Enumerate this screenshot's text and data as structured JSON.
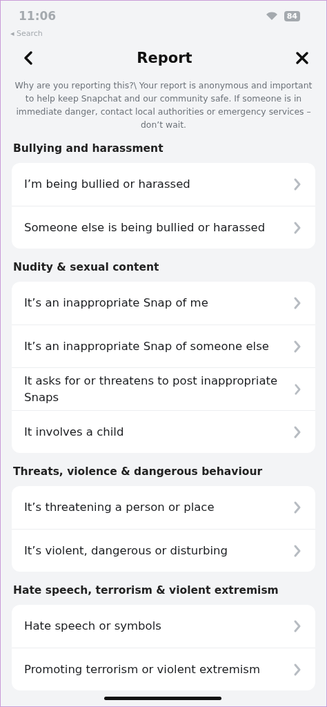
{
  "status_bar": {
    "time": "11:06",
    "back_link": "◂ Search",
    "battery": "84"
  },
  "header": {
    "title": "Report"
  },
  "intro": "Why are you reporting this?\\ Your report is anonymous and important to help keep Snapchat and our community safe. If someone is in immediate danger, contact local authorities or emergency services – don’t wait.",
  "sections": [
    {
      "title": "Bullying and harassment",
      "items": [
        "I’m being bullied or harassed",
        "Someone else is being bullied or harassed"
      ]
    },
    {
      "title": "Nudity & sexual content",
      "items": [
        "It’s an inappropriate Snap of me",
        "It’s an inappropriate Snap of someone else",
        "It asks for or threatens to post inappropriate Snaps",
        "It involves a child"
      ]
    },
    {
      "title": "Threats, violence & dangerous behaviour",
      "items": [
        "It’s threatening a person or place",
        "It’s violent, dangerous or disturbing"
      ]
    },
    {
      "title": "Hate speech, terrorism & violent extremism",
      "items": [
        "Hate speech or symbols",
        "Promoting terrorism or violent extremism"
      ]
    }
  ]
}
